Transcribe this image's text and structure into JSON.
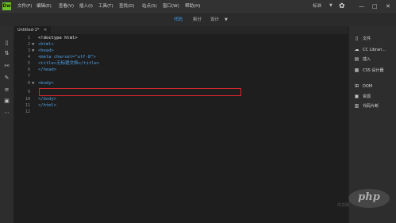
{
  "app": {
    "logo": "Dw",
    "menu": [
      "文件(F)",
      "编辑(E)",
      "查看(V)",
      "插入(I)",
      "工具(T)",
      "查找(D)",
      "站点(S)",
      "窗口(W)",
      "帮助(H)"
    ],
    "layout_selector": "标准",
    "window_controls": [
      "—",
      "□",
      "✕"
    ]
  },
  "modes": [
    "代码",
    "拆分",
    "设计"
  ],
  "active_mode": "代码",
  "document_tab": "Untitled-1*",
  "editor": {
    "lines": [
      {
        "n": "1",
        "fold": "",
        "code": "<!doctype html>"
      },
      {
        "n": "2",
        "fold": "▼",
        "code": "<html>"
      },
      {
        "n": "3",
        "fold": "▼",
        "code": "<head>"
      },
      {
        "n": "4",
        "fold": "",
        "code": "<meta charset=\"utf-8\">"
      },
      {
        "n": "5",
        "fold": "",
        "code": "<title>无标题文档</title>"
      },
      {
        "n": "6",
        "fold": "",
        "code": "</head>"
      },
      {
        "n": "7",
        "fold": "",
        "code": ""
      },
      {
        "n": "8",
        "fold": "▼",
        "code": "<body>"
      },
      {
        "n": "9",
        "fold": "",
        "code": ""
      },
      {
        "n": "10",
        "fold": "",
        "code": "</body>"
      },
      {
        "n": "11",
        "fold": "",
        "code": "</html>"
      },
      {
        "n": "12",
        "fold": "",
        "code": ""
      }
    ]
  },
  "right_panel": [
    {
      "icon": "file-icon",
      "label": "文件"
    },
    {
      "icon": "cloud-library-icon",
      "label": "CC Librari..."
    },
    {
      "icon": "insert-icon",
      "label": "插入"
    },
    {
      "icon": "css-designer-icon",
      "label": "CSS 设计器"
    },
    {
      "icon": "dom-icon",
      "label": "DOM"
    },
    {
      "icon": "assets-icon",
      "label": "资源"
    },
    {
      "icon": "snippets-icon",
      "label": "代码片断"
    }
  ],
  "watermark": {
    "text": "php",
    "subtext": "中文网"
  },
  "colors": {
    "accent": "#3fa6ff",
    "highlight_box": "#d3262e",
    "tag": "#4ea1e6",
    "text": "#e6e6e6"
  }
}
